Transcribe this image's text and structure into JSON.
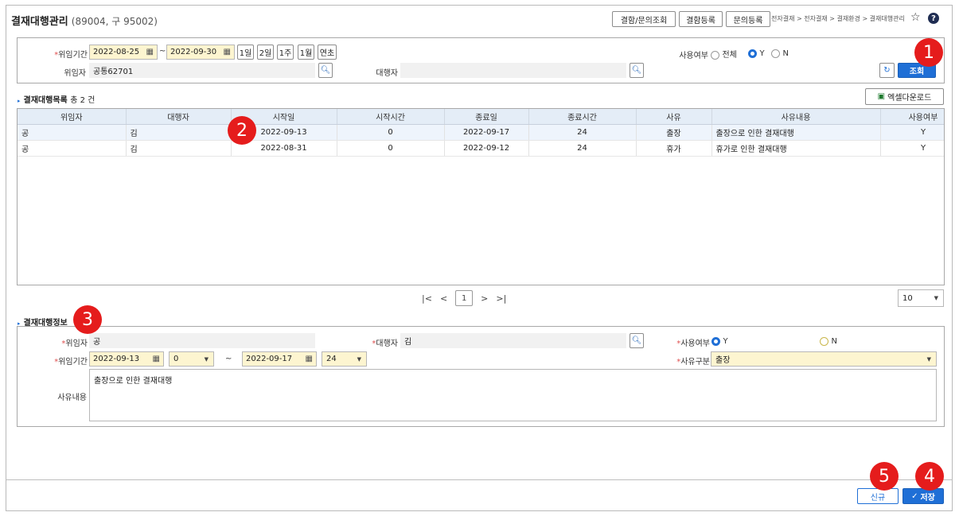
{
  "header": {
    "title": "결재대행관리",
    "subtitle": "(89004, 구 95002)",
    "buttons": [
      "결함/문의조회",
      "결함등록",
      "문의등록"
    ],
    "breadcrumb": "전자결재 > 전자결재 > 결재환경 > 결재대행관리",
    "help_label": "?"
  },
  "search": {
    "period_label": "위임기간",
    "date_from": "2022-08-25",
    "tilde": "~",
    "date_to": "2022-09-30",
    "quick_buttons": [
      "1일",
      "2일",
      "1주",
      "1월",
      "연초"
    ],
    "delegator_label": "위임자",
    "delegator_value": "공통62701",
    "proxy_label": "대행자",
    "proxy_value": "",
    "use_label": "사용여부",
    "use_options": [
      "전체",
      "Y",
      "N"
    ],
    "use_selected": "Y",
    "search_button": "조회"
  },
  "list": {
    "title": "결재대행목록",
    "count_text": "총 2 건",
    "excel_button": "엑셀다운로드",
    "columns": [
      "위임자",
      "대행자",
      "시작일",
      "시작시간",
      "종료일",
      "종료시간",
      "사유",
      "사유내용",
      "사용여부"
    ],
    "rows": [
      [
        "공",
        "김",
        "2022-09-13",
        "0",
        "2022-09-17",
        "24",
        "출장",
        "출장으로 인한 결재대행",
        "Y"
      ],
      [
        "공",
        "김",
        "2022-08-31",
        "0",
        "2022-09-12",
        "24",
        "휴가",
        "휴가로 인한 결재대행",
        "Y"
      ]
    ]
  },
  "pager": {
    "first": "|<",
    "prev": "<",
    "page": "1",
    "next": ">",
    "last": ">|",
    "page_size": "10"
  },
  "detail": {
    "title": "결재대행정보",
    "delegator_label": "위임자",
    "delegator_value": "공",
    "proxy_label": "대행자",
    "proxy_value": "김",
    "use_label": "사용여부",
    "use_y": "Y",
    "use_n": "N",
    "period_label": "위임기간",
    "date_from": "2022-09-13",
    "hour_from": "0",
    "tilde": "~",
    "date_to": "2022-09-17",
    "hour_to": "24",
    "reason_type_label": "사유구분",
    "reason_type_value": "출장",
    "reason_label": "사유내용",
    "reason_value": "출장으로 인한 결재대행"
  },
  "footer": {
    "new_button": "신규",
    "save_button": "저장"
  },
  "markers": [
    "1",
    "2",
    "3",
    "4",
    "5"
  ],
  "colors": {
    "accent": "#1f6fd6",
    "marker": "#e51c1c",
    "required_field": "#fdf5d0",
    "grid_header": "#e4edf7"
  }
}
